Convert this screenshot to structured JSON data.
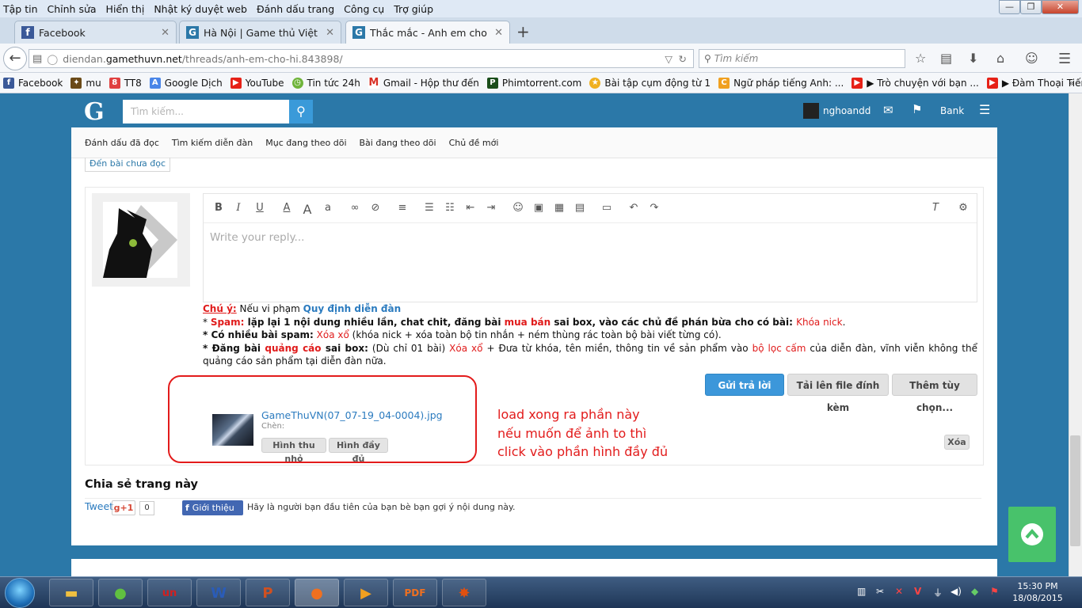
{
  "menubar": [
    "Tập tin",
    "Chỉnh sửa",
    "Hiển thị",
    "Nhật ký duyệt web",
    "Đánh dấu trang",
    "Công cụ",
    "Trợ giúp"
  ],
  "tabs": [
    {
      "title": "Facebook",
      "icon": "facebook-icon"
    },
    {
      "title": "Hà Nội | Game thủ Việt Na...",
      "icon": "gamethuvn-icon"
    },
    {
      "title": "Thắc mắc - Anh em cho h...",
      "icon": "gamethuvn-icon"
    }
  ],
  "url": {
    "prefix": "diendan.",
    "domain": "gamethuvn.net",
    "path": "/threads/anh-em-cho-hi.843898/"
  },
  "search_placeholder": "Tìm kiếm",
  "bookmarks": [
    "Facebook",
    "mu",
    "TT8",
    "Google Dịch",
    "YouTube",
    "Tin tức 24h",
    "Gmail - Hộp thư đến",
    "Phimtorrent.com",
    "Bài tập cụm động từ 1",
    "Ngữ pháp tiếng Anh: ...",
    "▶ Trò chuyện với bạn ...",
    "▶ Đàm Thoại Tiếng A..."
  ],
  "forum": {
    "logo": "G",
    "search_placeholder": "Tìm kiếm...",
    "username": "nghoandd",
    "bank": "Bank",
    "subnav": [
      "Đánh dấu đã đọc",
      "Tìm kiếm diễn đàn",
      "Mục đang theo dõi",
      "Bài đang theo dõi",
      "Chủ đề mới"
    ],
    "unread_link": "Đến bài chưa đọc",
    "editor_placeholder": "Write your reply...",
    "rules": {
      "l1_label": "Chú ý:",
      "l1_text": " Nếu vi phạm ",
      "l1_link": "Quy định diễn đàn",
      "l2_a": "* ",
      "l2_b": "Spam:",
      "l2_c": " lặp lại 1 nội dung nhiều lần, chat chit, đăng bài ",
      "l2_d": "mua bán",
      "l2_e": " sai box, vào các chủ đề phán bừa cho có bài: ",
      "l2_f": "Khóa nick",
      "l2_g": ".",
      "l3_a": "* Có nhiều bài spam:",
      "l3_b": " Xóa xổ",
      "l3_c": " (khóa nick + xóa toàn bộ tin nhắn + ném thùng rác toàn bộ bài viết từng có).",
      "l4_a": "* Đăng bài ",
      "l4_b": "quảng cáo",
      "l4_c": " sai box:",
      "l4_d": " (Dù chỉ 01 bài) ",
      "l4_e": "Xóa xổ",
      "l4_f": " + Đưa từ khóa, tên miền, thông tin về sản phẩm vào ",
      "l4_g": "bộ lọc cấm",
      "l4_h": " của diễn đàn, vĩnh viễn không thể quảng cáo sản phẩm tại diễn đàn nữa."
    },
    "buttons": {
      "submit": "Gửi trả lời",
      "upload": "Tải lên file đính kèm",
      "more": "Thêm tùy chọn..."
    },
    "attachment": {
      "filename": "GameThuVN(07_07-19_04-0004).jpg",
      "insert_label": "Chèn:",
      "thumb_btn": "Hình thu nhỏ",
      "full_btn": "Hình đầy đủ",
      "delete_btn": "Xóa"
    },
    "share": {
      "title": "Chia sẻ trang này",
      "tweet": "Tweet",
      "gplus": "g+1",
      "gcount": "0",
      "fb_btn": "Giới thiệu",
      "fb_text": "Hãy là người bạn đầu tiên của bạn bè bạn gợi ý nội dung này."
    }
  },
  "annotation": [
    "load xong ra phần này",
    "nếu muốn để ảnh to thì",
    "click vào phần hình đầy đủ"
  ],
  "taskbar": {
    "time": "15:30 PM",
    "date": "18/08/2015"
  },
  "colors": {
    "forum_blue": "#2b78a8",
    "accent_blue": "#3c97da",
    "annotation_red": "#e31b1b",
    "scroll_green": "#48c26b"
  }
}
